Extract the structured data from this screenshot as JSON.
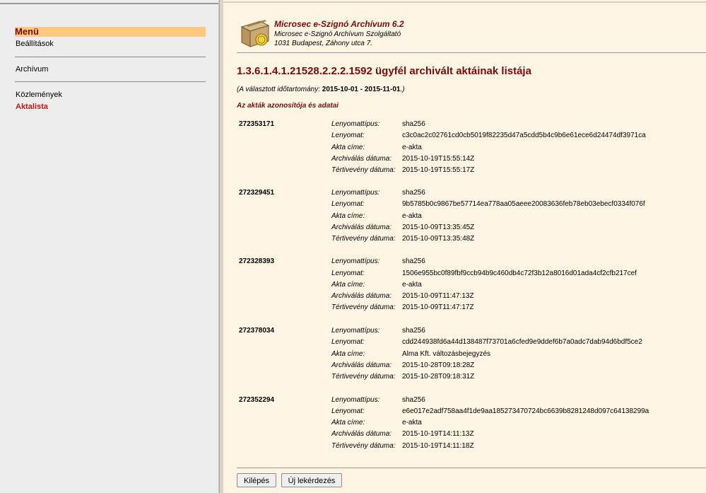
{
  "sidebar": {
    "menu_title": "Menü",
    "items": [
      {
        "label": "Beállítások",
        "active": false
      },
      {
        "label": "Archívum",
        "active": false
      },
      {
        "label": "Közlemények",
        "active": false
      },
      {
        "label": "Aktalista",
        "active": true
      }
    ]
  },
  "header": {
    "app_title": "Microsec e-Szignó Archívum 6.2",
    "provider": "Microsec e-Szignó Archívum Szolgáltató",
    "address": "1031 Budapest, Záhony utca 7."
  },
  "page": {
    "title": "1.3.6.1.4.1.21528.2.2.2.1592 ügyfél archivált aktáinak listája",
    "range_prefix": "(A választott időtartomány:",
    "range_value": "2015-10-01 - 2015-11-01",
    "range_suffix": ".)",
    "section_title": "Az akták azonosítója és adatai"
  },
  "labels": {
    "hash_type": "Lenyomattípus:",
    "hash": "Lenyomat:",
    "title": "Akta címe:",
    "archived": "Archiválás dátuma:",
    "receipt": "Tértivevény dátuma:"
  },
  "records": [
    {
      "id": "272353171",
      "hash_type": "sha256",
      "hash": "c3c0ac2c02761cd0cb5019f82235d47a5cdd5b4c9b6e61ece6d24474df3971ca",
      "title": "e-akta",
      "archived": "2015-10-19T15:55:14Z",
      "receipt": "2015-10-19T15:55:17Z"
    },
    {
      "id": "272329451",
      "hash_type": "sha256",
      "hash": "9b5785b0c9867be57714ea778aa05aeee20083636feb78eb03ebecf0334f076f",
      "title": "e-akta",
      "archived": "2015-10-09T13:35:45Z",
      "receipt": "2015-10-09T13:35:48Z"
    },
    {
      "id": "272328393",
      "hash_type": "sha256",
      "hash": "1506e955bc0f89fbf9ccb94b9c460db4c72f3b12a8016d01ada4cf2cfb217cef",
      "title": "e-akta",
      "archived": "2015-10-09T11:47:13Z",
      "receipt": "2015-10-09T11:47:17Z"
    },
    {
      "id": "272378034",
      "hash_type": "sha256",
      "hash": "cdd244938fd6a44d138487f73701a6cfed9e9ddef6b7a0adc7dab94d6bdf5ce2",
      "title": "Alma Kft. változásbejegyzés",
      "archived": "2015-10-28T09:18:28Z",
      "receipt": "2015-10-28T09:18:31Z"
    },
    {
      "id": "272352294",
      "hash_type": "sha256",
      "hash": "e6e017e2adf758aa4f1de9aa185273470724bc6639b8281248d097c64138299a",
      "title": "e-akta",
      "archived": "2015-10-19T14:11:13Z",
      "receipt": "2015-10-19T14:11:18Z"
    }
  ],
  "buttons": {
    "exit": "Kilépés",
    "new_query": "Új lekérdezés"
  },
  "colors": {
    "accent": "#7a0c0c",
    "active_link": "#cc1111",
    "menu_highlight": "#ffc880",
    "content_bg": "#fdf4e4",
    "sidebar_bg": "#ededed"
  },
  "icons": {
    "logo": "archive-box-icon"
  }
}
